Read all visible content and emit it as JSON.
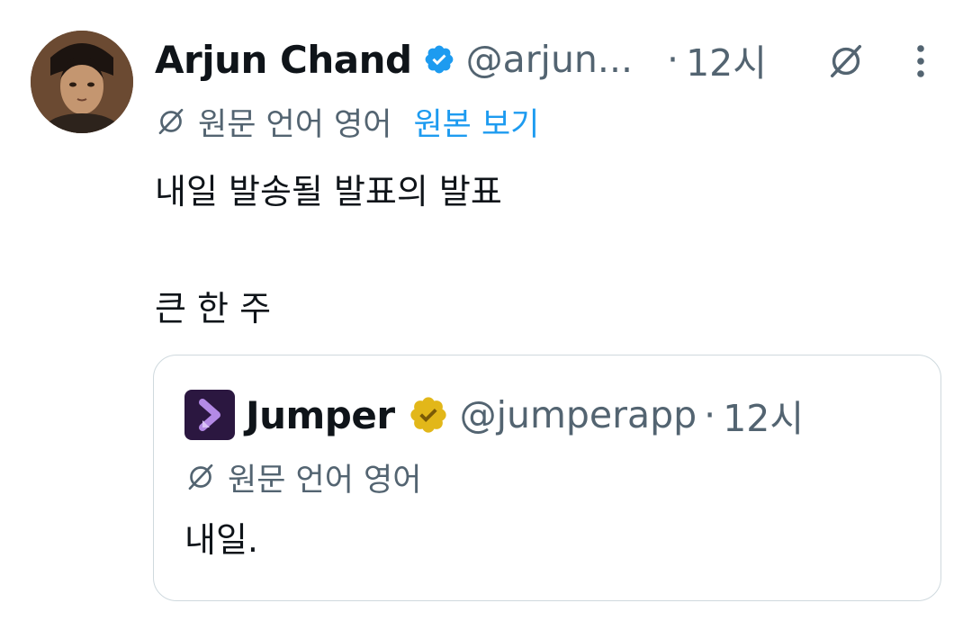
{
  "tweet": {
    "author_name": "Arjun Chand",
    "author_handle": "@arjun...",
    "separator": "·",
    "time": "12시",
    "translate_label": "원문 언어 영어",
    "view_original_link": "원본 보기",
    "text_line1": "내일 발송될 발표의 발표",
    "text_line2": "큰 한 주"
  },
  "quoted": {
    "author_name": "Jumper",
    "author_handle": "@jumperapp",
    "separator": "·",
    "time": "12시",
    "translate_label": "원문 언어 영어",
    "text": "내일."
  },
  "icons": {
    "verified_blue": "verified-badge-icon",
    "verified_gold": "verified-gold-badge-icon",
    "grok": "grok-icon",
    "more": "more-vertical-icon",
    "translate": "translate-icon",
    "jumper_logo": "jumper-logo-icon"
  },
  "colors": {
    "text_primary": "#0f1419",
    "text_secondary": "#536471",
    "link_blue": "#1d9bf0",
    "verified_blue": "#1d9bf0",
    "verified_gold": "#e2b719",
    "border": "#cfd9de",
    "jumper_bg": "#2b1740",
    "jumper_accent": "#b48ae6"
  }
}
